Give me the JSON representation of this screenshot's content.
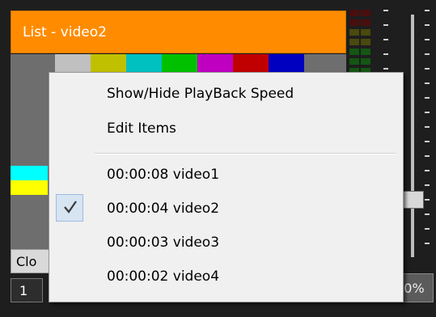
{
  "panel": {
    "title": "List - video2",
    "clo_label": "Clo",
    "num_label": "1",
    "pct_label": "0%",
    "colorbars": [
      "#c0c0c0",
      "#c0c000",
      "#00c0c0",
      "#00c000",
      "#c000c0",
      "#c00000",
      "#0000c0",
      "#6e6e6e"
    ],
    "swatches": [
      "#00ffff",
      "#ffff00"
    ]
  },
  "context_menu": {
    "items": [
      {
        "label": "Show/Hide PlayBack Speed",
        "checked": false
      },
      {
        "label": "Edit Items",
        "checked": false
      },
      {
        "label": "00:00:08 video1",
        "checked": false
      },
      {
        "label": "00:00:04 video2",
        "checked": true
      },
      {
        "label": "00:00:03 video3",
        "checked": false
      },
      {
        "label": "00:00:02 video4",
        "checked": false
      }
    ]
  },
  "icons": {
    "check": "check-icon"
  }
}
